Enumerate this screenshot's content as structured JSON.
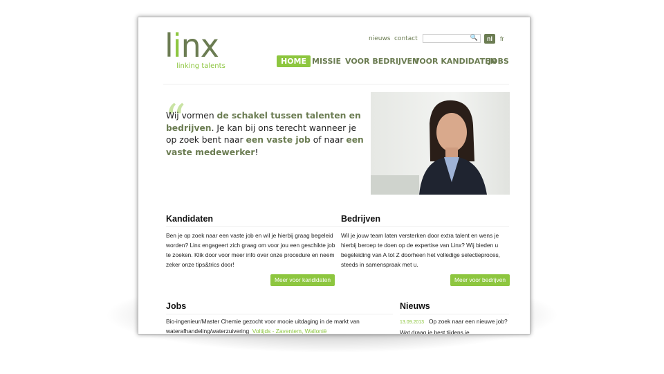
{
  "logo": {
    "name_pre": "l",
    "name_i": "i",
    "name_post": "nx",
    "tagline": "linking talents"
  },
  "toplinks": {
    "news": "nieuws",
    "contact": "contact",
    "search_placeholder": "",
    "lang_nl": "nl",
    "lang_fr": "fr"
  },
  "nav": [
    "HOME",
    "MISSIE",
    "VOOR BEDRIJVEN",
    "VOOR KANDIDATEN",
    "JOBS"
  ],
  "intro": {
    "t1": "Wij vormen ",
    "b1": "de schakel tussen talenten en bedrijven",
    "t2": ". Je kan bij ons terecht wanneer je op zoek bent naar ",
    "b2": "een vaste job",
    "t3": " of naar ",
    "b3": "een vaste medewerker",
    "t4": "!"
  },
  "kandidaten": {
    "title": "Kandidaten",
    "text": "Ben je op zoek naar een vaste job en wil je hierbij graag begeleid worden? Linx engageert zich graag om voor jou een geschikte job te zoeken. Klik door voor meer info over onze procedure en neem zeker onze tips&trics door!",
    "button": "Meer voor kandidaten"
  },
  "bedrijven": {
    "title": "Bedrijven",
    "text": "Wil je jouw team laten versterken door extra talent en wens je hierbij beroep te doen op de expertise van Linx? Wij bieden u begeleiding van A tot Z doorheen het volledige selectieproces, steeds in samenspraak met u.",
    "button": "Meer voor bedrijven"
  },
  "jobs": {
    "title": "Jobs",
    "item_text": "Bio-ingenieur/Master Chemie gezocht voor mooie uitdaging in de markt van waterafhandeling/waterzuivering",
    "item_meta": "Voltijds - Zaventem, Wallonië"
  },
  "news": {
    "title": "Nieuws",
    "date": "13.09.2013",
    "text": "Op zoek naar een nieuwe job? Wat draag je best tijdens je"
  }
}
